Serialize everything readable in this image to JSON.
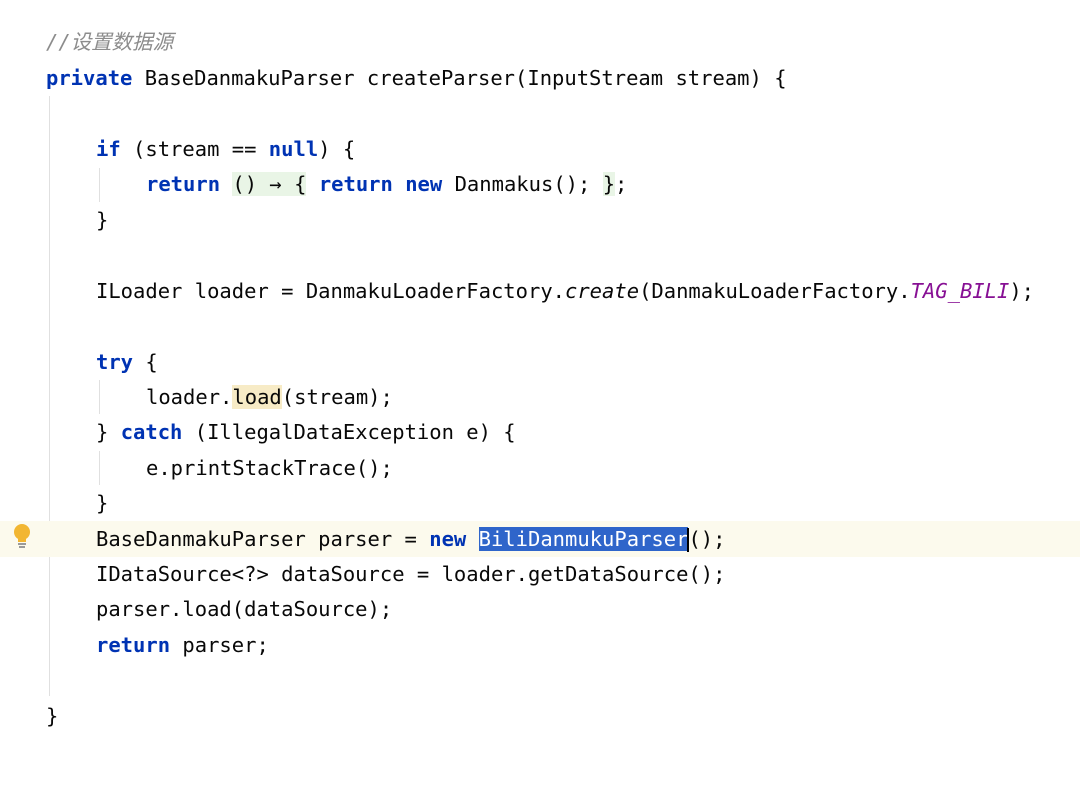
{
  "editor": {
    "comment": "//设置数据源",
    "lines": {
      "signature": {
        "private_kw": "private",
        "text": " BaseDanmakuParser createParser(InputStream stream) {"
      },
      "if_stmt": {
        "if_kw": "if",
        "pre": " (stream == ",
        "null_kw": "null",
        "post": ") {"
      },
      "return_lambda": {
        "return_kw": "return",
        "lambda_open": "() → {",
        "return_kw2": "return",
        "new_kw": "new",
        "body": " Danmakus(); ",
        "lambda_close": "}",
        "semicolon": ";"
      },
      "if_close": "}",
      "iloader": {
        "pre": "ILoader loader = DanmakuLoaderFactory.",
        "method": "create",
        "mid": "(DanmakuLoaderFactory.",
        "constant": "TAG_BILI",
        "post": ");"
      },
      "try_stmt": {
        "try_kw": "try",
        "post": " {"
      },
      "loader_load": {
        "pre": "loader.",
        "method": "load",
        "post": "(stream);"
      },
      "catch_stmt": {
        "pre": "} ",
        "catch_kw": "catch",
        "post": " (IllegalDataException e) {"
      },
      "print_stack": "e.printStackTrace();",
      "try_close": "}",
      "parser_decl": {
        "pre": "BaseDanmakuParser parser = ",
        "new_kw": "new",
        "space": " ",
        "selected": "BiliDanmukuParser",
        "post": "();"
      },
      "datasource_decl": "IDataSource<?> dataSource = loader.getDataSource();",
      "parser_load": "parser.load(dataSource);",
      "return_parser": {
        "return_kw": "return",
        "post": " parser;"
      },
      "method_close": "}"
    },
    "gutter": {
      "intention_icon": "lightbulb-icon"
    },
    "colors": {
      "keyword": "#0033b3",
      "comment": "#8c8c8c",
      "constant": "#871094",
      "selection": "#2f65ca",
      "caret_line": "#fcfaed",
      "lambda_background": "#e9f5e6",
      "identifier_highlight": "#f7ebc6",
      "intention_bulb": "#f2b632"
    }
  }
}
